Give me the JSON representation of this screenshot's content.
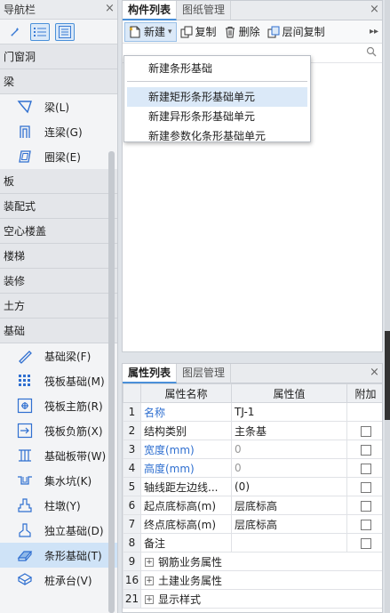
{
  "nav": {
    "title": "导航栏",
    "categories": {
      "door": "门窗洞",
      "beam": "梁",
      "slab": "板",
      "prefab": "装配式",
      "hollow": "空心楼盖",
      "stair": "楼梯",
      "decor": "装修",
      "earth": "土方",
      "foundation": "基础"
    },
    "beam_items": [
      {
        "label": "梁(L)",
        "icon": "beam-icon"
      },
      {
        "label": "连梁(G)",
        "icon": "coupling-beam-icon"
      },
      {
        "label": "圈梁(E)",
        "icon": "ring-beam-icon"
      }
    ],
    "foundation_items": [
      {
        "label": "基础梁(F)",
        "icon": "foundation-beam-icon"
      },
      {
        "label": "筏板基础(M)",
        "icon": "raft-foundation-icon"
      },
      {
        "label": "筏板主筋(R)",
        "icon": "raft-main-rebar-icon"
      },
      {
        "label": "筏板负筋(X)",
        "icon": "raft-negative-rebar-icon"
      },
      {
        "label": "基础板带(W)",
        "icon": "foundation-strip-icon"
      },
      {
        "label": "集水坑(K)",
        "icon": "sump-icon"
      },
      {
        "label": "柱墩(Y)",
        "icon": "column-pier-icon"
      },
      {
        "label": "独立基础(D)",
        "icon": "isolated-footing-icon"
      },
      {
        "label": "条形基础(T)",
        "icon": "strip-foundation-icon"
      },
      {
        "label": "桩承台(V)",
        "icon": "pile-cap-icon"
      }
    ]
  },
  "component_panel": {
    "tabs": [
      "构件列表",
      "图纸管理"
    ],
    "toolbar": {
      "new_label": "新建",
      "copy_label": "复制",
      "delete_label": "删除",
      "floor_copy_label": "层间复制"
    },
    "dropdown": [
      "新建条形基础",
      "新建矩形条形基础单元",
      "新建异形条形基础单元",
      "新建参数化条形基础单元"
    ]
  },
  "property_panel": {
    "tabs": [
      "属性列表",
      "图层管理"
    ],
    "columns": [
      "属性名称",
      "属性值",
      "附加"
    ],
    "rows": [
      {
        "num": "1",
        "name": "名称",
        "value": "TJ-1",
        "blue": true,
        "grey": false,
        "check": false
      },
      {
        "num": "2",
        "name": "结构类别",
        "value": "主条基",
        "blue": false,
        "grey": false,
        "check": true
      },
      {
        "num": "3",
        "name": "宽度(mm)",
        "value": "0",
        "blue": true,
        "grey": true,
        "check": true
      },
      {
        "num": "4",
        "name": "高度(mm)",
        "value": "0",
        "blue": true,
        "grey": true,
        "check": true
      },
      {
        "num": "5",
        "name": "轴线距左边线...",
        "value": "(0)",
        "blue": false,
        "grey": false,
        "check": true
      },
      {
        "num": "6",
        "name": "起点底标高(m)",
        "value": "层底标高",
        "blue": false,
        "grey": false,
        "check": true
      },
      {
        "num": "7",
        "name": "终点底标高(m)",
        "value": "层底标高",
        "blue": false,
        "grey": false,
        "check": true
      },
      {
        "num": "8",
        "name": "备注",
        "value": "",
        "blue": false,
        "grey": false,
        "check": true
      }
    ],
    "groups": [
      {
        "num": "9",
        "name": "钢筋业务属性"
      },
      {
        "num": "16",
        "name": "土建业务属性"
      },
      {
        "num": "21",
        "name": "显示样式"
      }
    ]
  },
  "colors": {
    "accent": "#4a90d9",
    "link_blue": "#2f6fd0",
    "selected": "#cfe3f7"
  }
}
